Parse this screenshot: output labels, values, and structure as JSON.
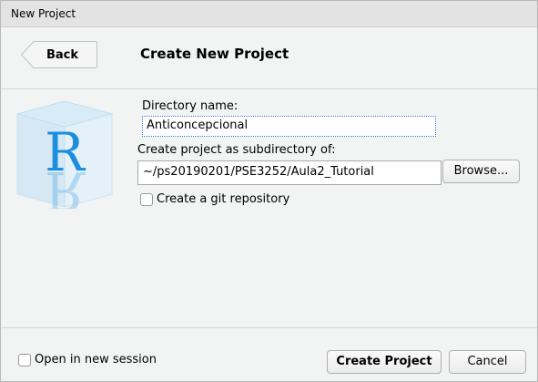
{
  "window": {
    "title": "New Project"
  },
  "header": {
    "back_label": "Back",
    "title": "Create New Project"
  },
  "form": {
    "directory_label": "Directory name:",
    "directory_value": "Anticoncepcional",
    "subdir_label": "Create project as subdirectory of:",
    "subdir_value": "~/ps20190201/PSE3252/Aula2_Tutorial",
    "browse_label": "Browse...",
    "git_label": "Create a git repository",
    "git_checked": false
  },
  "footer": {
    "new_session_label": "Open in new session",
    "new_session_checked": false,
    "create_label": "Create Project",
    "cancel_label": "Cancel"
  }
}
